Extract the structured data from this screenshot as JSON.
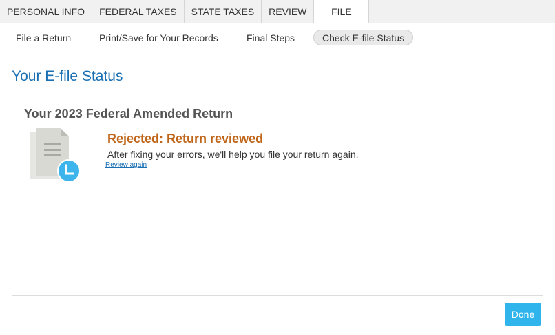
{
  "top_tabs": [
    {
      "label": "PERSONAL INFO"
    },
    {
      "label": "FEDERAL TAXES"
    },
    {
      "label": "STATE TAXES"
    },
    {
      "label": "REVIEW"
    },
    {
      "label": "FILE",
      "active": true
    }
  ],
  "sub_nav": [
    {
      "label": "File a Return"
    },
    {
      "label": "Print/Save for Your Records"
    },
    {
      "label": "Final Steps"
    },
    {
      "label": "Check E-file Status",
      "active": true
    }
  ],
  "page": {
    "title": "Your E-file Status",
    "section_title": "Your 2023 Federal Amended Return",
    "status_title": "Rejected: Return reviewed",
    "status_description": "After fixing your errors, we'll help you file your return again.",
    "review_link": "Review again",
    "status_icon": "document-clock-icon"
  },
  "footer": {
    "done_label": "Done"
  },
  "colors": {
    "title_blue": "#1a6fb3",
    "status_orange": "#c0661a",
    "button_blue": "#2fb5ec",
    "clock_blue": "#3db4ec"
  }
}
